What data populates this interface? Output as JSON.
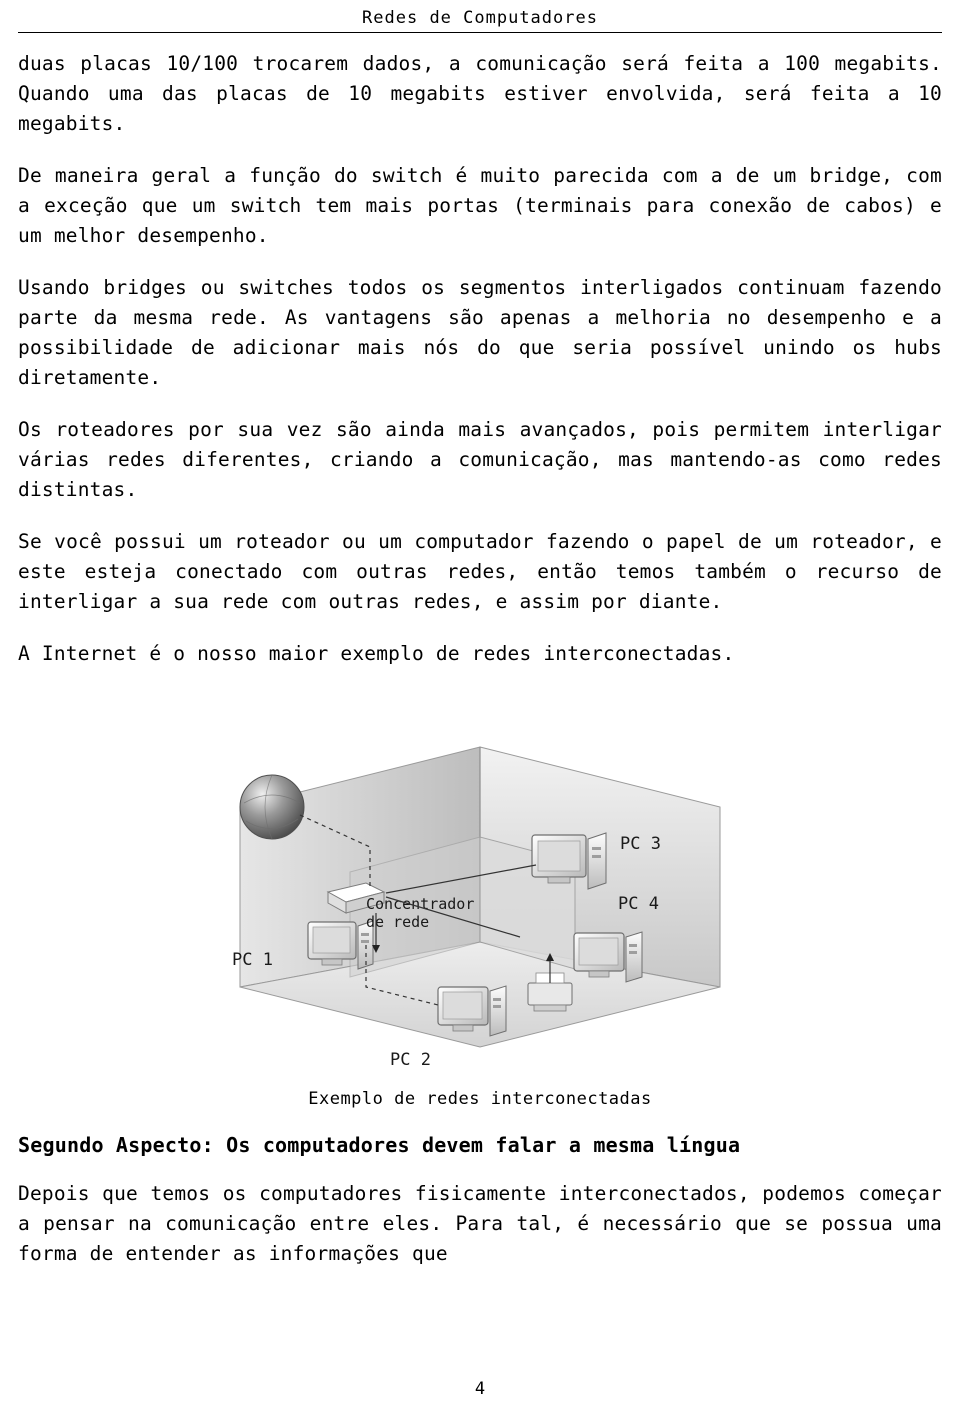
{
  "header": {
    "title": "Redes de Computadores"
  },
  "paragraphs": [
    "duas placas 10/100 trocarem dados, a comunicação será feita a 100 megabits. Quando uma das placas de 10 megabits estiver envolvida, será feita a 10 megabits.",
    "De maneira geral a função do switch é muito parecida com a de um bridge, com a exceção que um switch tem mais portas (terminais para conexão de cabos) e um melhor desempenho.",
    "Usando bridges ou switches todos os segmentos interligados continuam fazendo parte da mesma rede. As vantagens são apenas a melhoria no desempenho e a possibilidade de adicionar mais nós do que seria possível unindo os hubs diretamente.",
    "Os roteadores por sua vez são ainda mais avançados, pois permitem interligar várias redes diferentes, criando a comunicação, mas mantendo-as como redes distintas.",
    "Se você possui um roteador ou um computador fazendo o papel de um roteador, e este esteja conectado com outras redes, então temos também o recurso de interligar a sua rede com outras redes, e assim por diante.",
    "A Internet é o nosso maior exemplo de redes interconectadas."
  ],
  "figure": {
    "caption": "Exemplo de redes interconectadas",
    "labels": {
      "pc1": "PC 1",
      "pc2": "PC 2",
      "pc3": "PC 3",
      "pc4": "PC 4",
      "hub_line1": "Concentrador",
      "hub_line2": "de rede"
    }
  },
  "section": {
    "heading": "Segundo Aspecto: Os computadores devem falar a mesma língua",
    "paragraph": "Depois que temos os computadores fisicamente interconectados, podemos começar a pensar na comunicação entre eles. Para tal, é necessário que se possua uma forma de entender as informações que"
  },
  "footer": {
    "page_number": "4"
  }
}
